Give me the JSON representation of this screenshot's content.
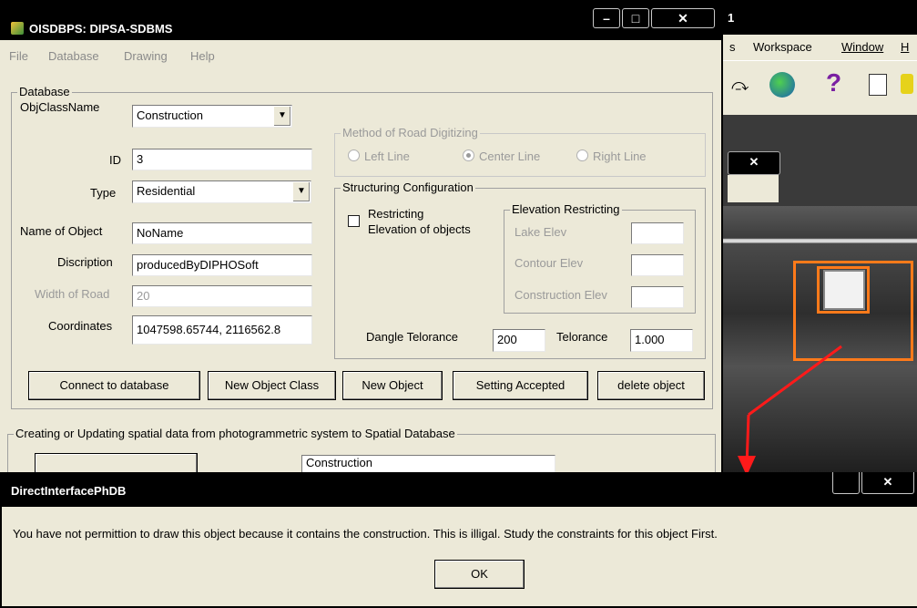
{
  "outer": {
    "title_fragment": "1",
    "menu": [
      "s",
      "Workspace",
      "Window",
      "H"
    ]
  },
  "main": {
    "title": "OISDBPS: DIPSA-SDBMS",
    "menu": [
      "File",
      "Database",
      "Drawing",
      "Help"
    ],
    "database": {
      "legend": "Database",
      "objclass_label": "ObjClassName",
      "objclass_value": "Construction",
      "id_label": "ID",
      "id_value": "3",
      "type_label": "Type",
      "type_value": "Residential",
      "name_label": "Name of Object",
      "name_value": "NoName",
      "desc_label": "Discription",
      "desc_value": "producedByDIPHOSoft",
      "width_label": "Width of Road",
      "width_value": "20",
      "coords_label": "Coordinates",
      "coords_value": "1047598.65744, 2116562.8"
    },
    "method": {
      "legend": "Method of Road Digitizing",
      "left": "Left Line",
      "center": "Center Line",
      "right": "Right Line"
    },
    "structuring": {
      "legend": "Structuring Configuration",
      "restrict_line1": "Restricting",
      "restrict_line2": "Elevation of objects",
      "elev_legend": "Elevation Restricting",
      "lake": "Lake Elev",
      "contour": "Contour Elev",
      "construction": "Construction Elev",
      "dangle_label": "Dangle Telorance",
      "dangle_value": "200",
      "tol_label": "Telorance",
      "tol_value": "1.000"
    },
    "buttons": {
      "connect": "Connect to database",
      "new_class": "New Object Class",
      "new_object": "New Object",
      "setting": "Setting Accepted",
      "delete": "delete object"
    },
    "spatial": {
      "legend": "Creating or Updating spatial data from photogrammetric system to Spatial Database",
      "field_value": "Construction"
    }
  },
  "dialog": {
    "title": "DirectInterfacePhDB",
    "message": "You have not permittion to draw this object because it contains the construction. This is illigal. Study the constraints for this object First.",
    "ok": "OK"
  },
  "colors": {
    "title_bar": "#000000",
    "face": "#ece9d8",
    "highlight": "#ff7a1a",
    "arrow": "#ff1a1a"
  }
}
